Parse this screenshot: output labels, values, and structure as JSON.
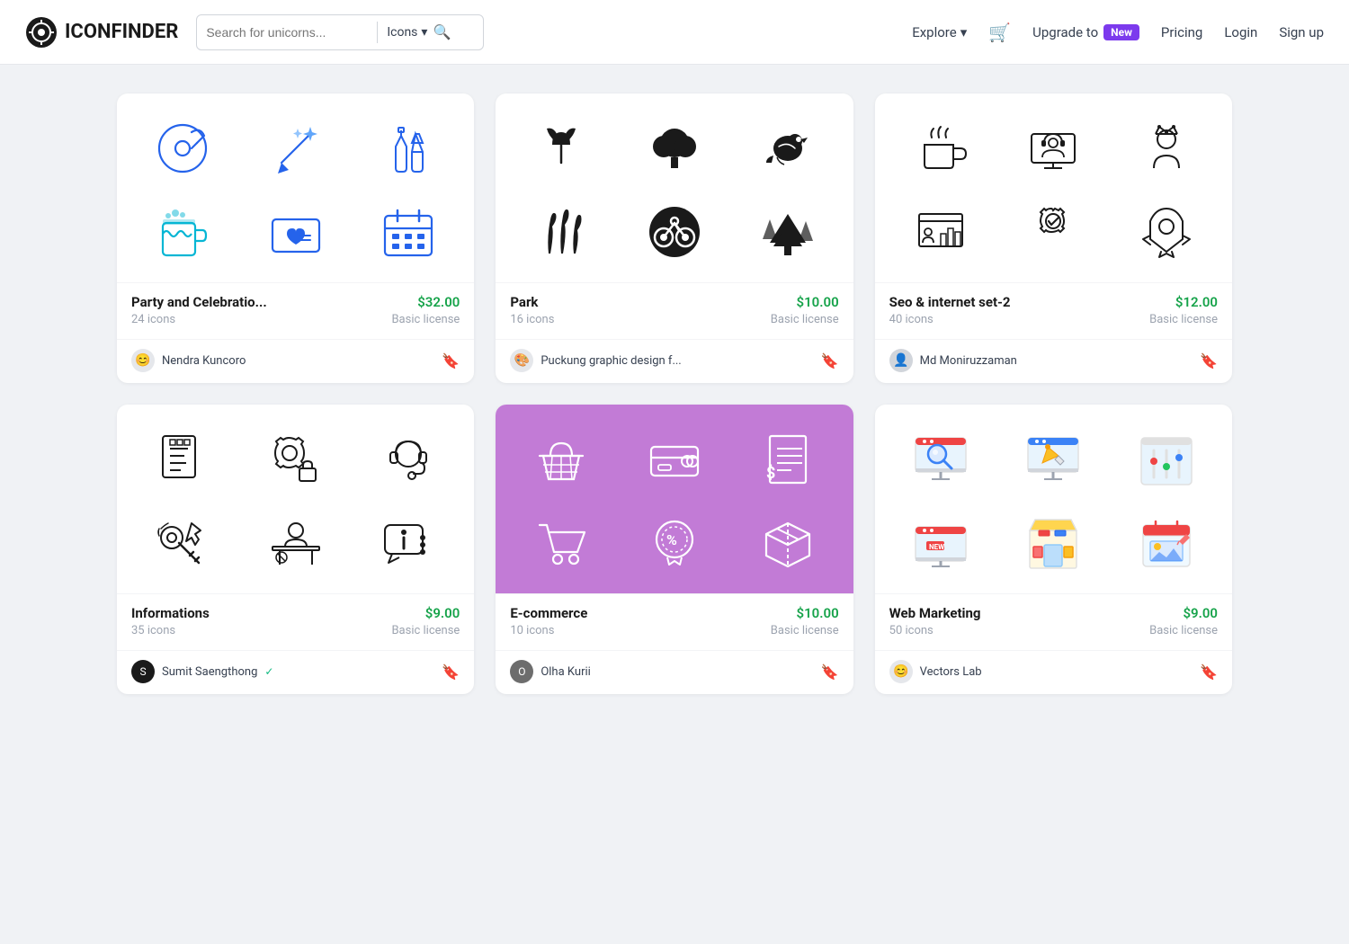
{
  "header": {
    "logo_text": "ICONFINDER",
    "search_placeholder": "Search for unicorns...",
    "search_type": "Icons",
    "nav_explore": "Explore",
    "nav_upgrade_prefix": "Upgrade to",
    "nav_new_badge": "New",
    "nav_pricing": "Pricing",
    "nav_login": "Login",
    "nav_signup": "Sign up"
  },
  "cards": [
    {
      "id": "party",
      "title": "Party and Celebratio...",
      "price": "$32.00",
      "count": "24 icons",
      "license": "Basic license",
      "author": "Nendra Kuncoro",
      "bg": "white",
      "style": "outline-blue"
    },
    {
      "id": "park",
      "title": "Park",
      "price": "$10.00",
      "count": "16 icons",
      "license": "Basic license",
      "author": "Puckung graphic design f...",
      "bg": "white",
      "style": "filled-black"
    },
    {
      "id": "seo",
      "title": "Seo & internet set-2",
      "price": "$12.00",
      "count": "40 icons",
      "license": "Basic license",
      "author": "Md Moniruzzaman",
      "bg": "white",
      "style": "outline-black"
    },
    {
      "id": "informations",
      "title": "Informations",
      "price": "$9.00",
      "count": "35 icons",
      "license": "Basic license",
      "author": "Sumit Saengthong",
      "author_verified": true,
      "bg": "white",
      "style": "outline-black"
    },
    {
      "id": "ecommerce",
      "title": "E-commerce",
      "price": "$10.00",
      "count": "10 icons",
      "license": "Basic license",
      "author": "Olha Kurii",
      "bg": "purple",
      "style": "outline-white"
    },
    {
      "id": "webmarketing",
      "title": "Web Marketing",
      "price": "$9.00",
      "count": "50 icons",
      "license": "Basic license",
      "author": "Vectors Lab",
      "bg": "white",
      "style": "color"
    }
  ]
}
